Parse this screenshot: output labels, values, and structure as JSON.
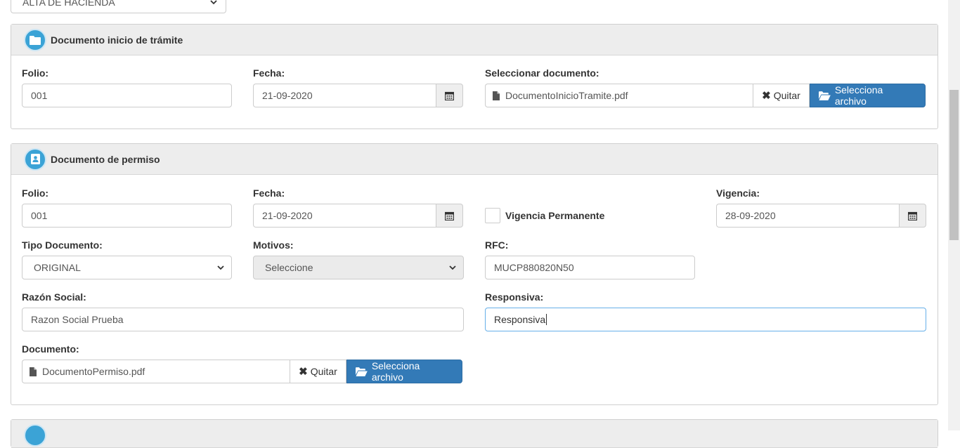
{
  "top_select": {
    "value": "ALTA DE HACIENDA"
  },
  "panel_inicio": {
    "title": "Documento inicio de trámite",
    "folio_label": "Folio:",
    "folio_value": "001",
    "fecha_label": "Fecha:",
    "fecha_value": "21-09-2020",
    "doc_label": "Seleccionar documento:",
    "doc_filename": "DocumentoInicioTramite.pdf",
    "quitar_label": "Quitar",
    "selecciona_label": "Selecciona archivo"
  },
  "panel_permiso": {
    "title": "Documento de permiso",
    "folio_label": "Folio:",
    "folio_value": "001",
    "fecha_label": "Fecha:",
    "fecha_value": "21-09-2020",
    "vigencia_perm_label": "Vigencia Permanente",
    "vigencia_label": "Vigencia:",
    "vigencia_value": "28-09-2020",
    "tipo_label": "Tipo Documento:",
    "tipo_value": "ORIGINAL",
    "motivos_label": "Motivos:",
    "motivos_value": "Seleccione",
    "rfc_label": "RFC:",
    "rfc_value": "MUCP880820N50",
    "razon_label": "Razón Social:",
    "razon_value": "Razon Social Prueba",
    "responsiva_label": "Responsiva:",
    "responsiva_value": "Responsiva",
    "documento_label": "Documento:",
    "doc_filename": "DocumentoPermiso.pdf",
    "quitar_label": "Quitar",
    "selecciona_label": "Selecciona archivo"
  },
  "icons": {
    "folder": "folder-icon",
    "contact": "contact-book-icon",
    "calendar": "calendar-icon",
    "file": "file-icon",
    "remove": "times-icon",
    "folder_open": "folder-open-icon",
    "chevron": "chevron-down-icon"
  },
  "colors": {
    "primary": "#337ab7",
    "heading_icon": "#3ba3d6",
    "panel_heading_bg": "#ededed"
  }
}
